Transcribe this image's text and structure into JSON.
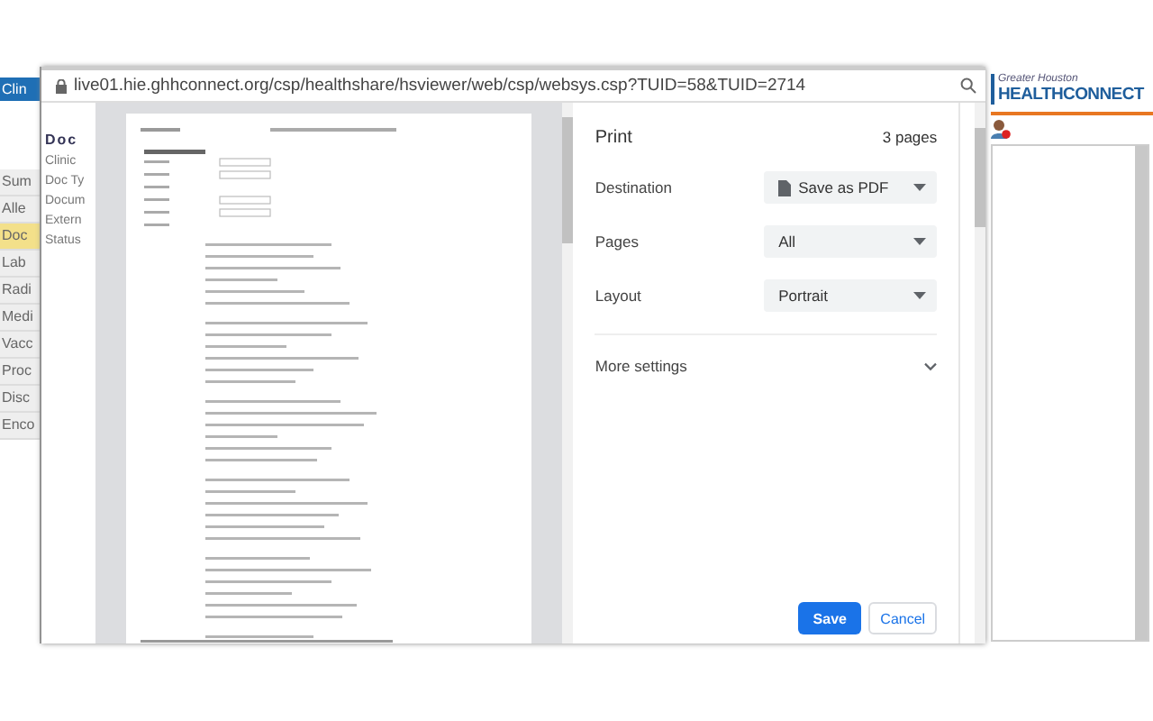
{
  "background_app": {
    "header_tab": "Clin",
    "nav_items": [
      {
        "label": "Sum",
        "selected": false
      },
      {
        "label": "Alle",
        "selected": false
      },
      {
        "label": "Doc",
        "selected": true
      },
      {
        "label": "Lab",
        "selected": false
      },
      {
        "label": "Radi",
        "selected": false
      },
      {
        "label": "Medi",
        "selected": false
      },
      {
        "label": "Vacc",
        "selected": false
      },
      {
        "label": "Proc",
        "selected": false
      },
      {
        "label": "Disc",
        "selected": false
      },
      {
        "label": "Enco",
        "selected": false
      }
    ],
    "heading": "Doc",
    "fields": [
      "Clinic",
      "Doc Ty",
      "Docum",
      "Extern",
      "Status"
    ]
  },
  "address_bar": {
    "url": "live01.hie.ghhconnect.org/csp/healthshare/hsviewer/web/csp/websys.csp?TUID=58&TUID=2714"
  },
  "print": {
    "title": "Print",
    "page_count": "3 pages",
    "settings": [
      {
        "label": "Destination",
        "value": "Save as PDF",
        "kind": "destination"
      },
      {
        "label": "Pages",
        "value": "All",
        "kind": "select"
      },
      {
        "label": "Layout",
        "value": "Portrait",
        "kind": "select"
      }
    ],
    "more_settings": {
      "label": "More settings",
      "expanded": false
    },
    "buttons": [
      {
        "label": "Save",
        "kind": "primary"
      },
      {
        "label": "Cancel",
        "kind": "secondary"
      }
    ]
  },
  "logo": {
    "tagline": "Greater Houston",
    "name": "HEALTHCONNECT"
  }
}
